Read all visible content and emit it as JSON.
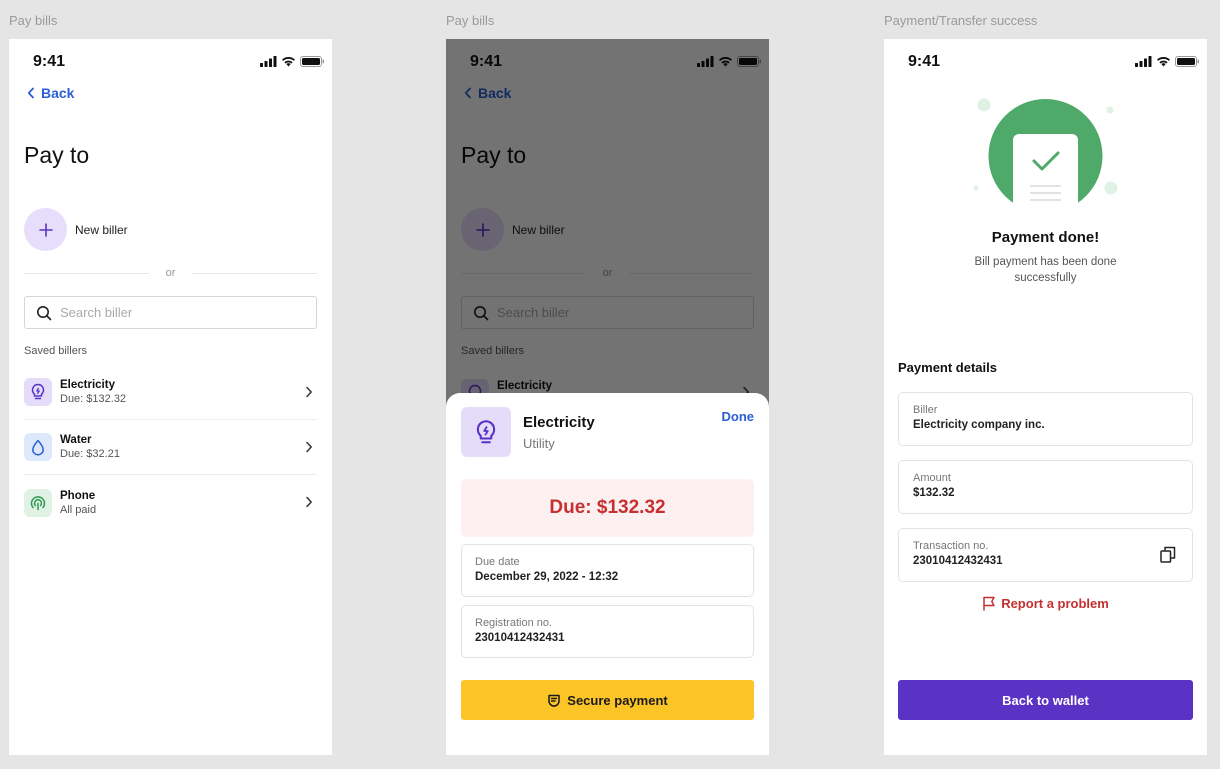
{
  "frames": {
    "first": "Pay bills",
    "second": "Pay bills",
    "third": "Payment/Transfer success"
  },
  "status": {
    "time": "9:41"
  },
  "back_label": "Back",
  "pay_to": {
    "title": "Pay to",
    "new_biller": "New biller",
    "or": "or",
    "search_placeholder": "Search biller",
    "saved_label": "Saved billers",
    "billers": [
      {
        "name": "Electricity",
        "status": "Due: $132.32",
        "icon": "lightbulb-icon",
        "icon_bg": "#e5dcfa",
        "icon_color": "#5b33c4"
      },
      {
        "name": "Water",
        "status": "Due: $32.21",
        "icon": "water-drop-icon",
        "icon_bg": "#dde9fb",
        "icon_color": "#2c5fd6"
      },
      {
        "name": "Phone",
        "status": "All paid",
        "icon": "signal-icon",
        "icon_bg": "#dff2e4",
        "icon_color": "#2e9a52"
      }
    ]
  },
  "sheet": {
    "title": "Electricity",
    "subtitle": "Utility",
    "done": "Done",
    "due": "Due: $132.32",
    "due_date_label": "Due date",
    "due_date_value": "December 29, 2022 - 12:32",
    "reg_label": "Registration no.",
    "reg_value": "23010412432431",
    "pay_button": "Secure payment"
  },
  "success": {
    "title": "Payment done!",
    "subtitle": "Bill payment has been done successfully",
    "details_title": "Payment details",
    "biller_label": "Biller",
    "biller_value": "Electricity company inc.",
    "amount_label": "Amount",
    "amount_value": "$132.32",
    "txn_label": "Transaction no.",
    "txn_value": "23010412432431",
    "report": "Report a problem",
    "back_button": "Back to wallet"
  },
  "colors": {
    "accent_purple": "#5b33c4",
    "link_blue": "#2c5fd6",
    "due_red": "#c73030",
    "pay_yellow": "#fcc527",
    "success_green": "#4faa6a"
  }
}
